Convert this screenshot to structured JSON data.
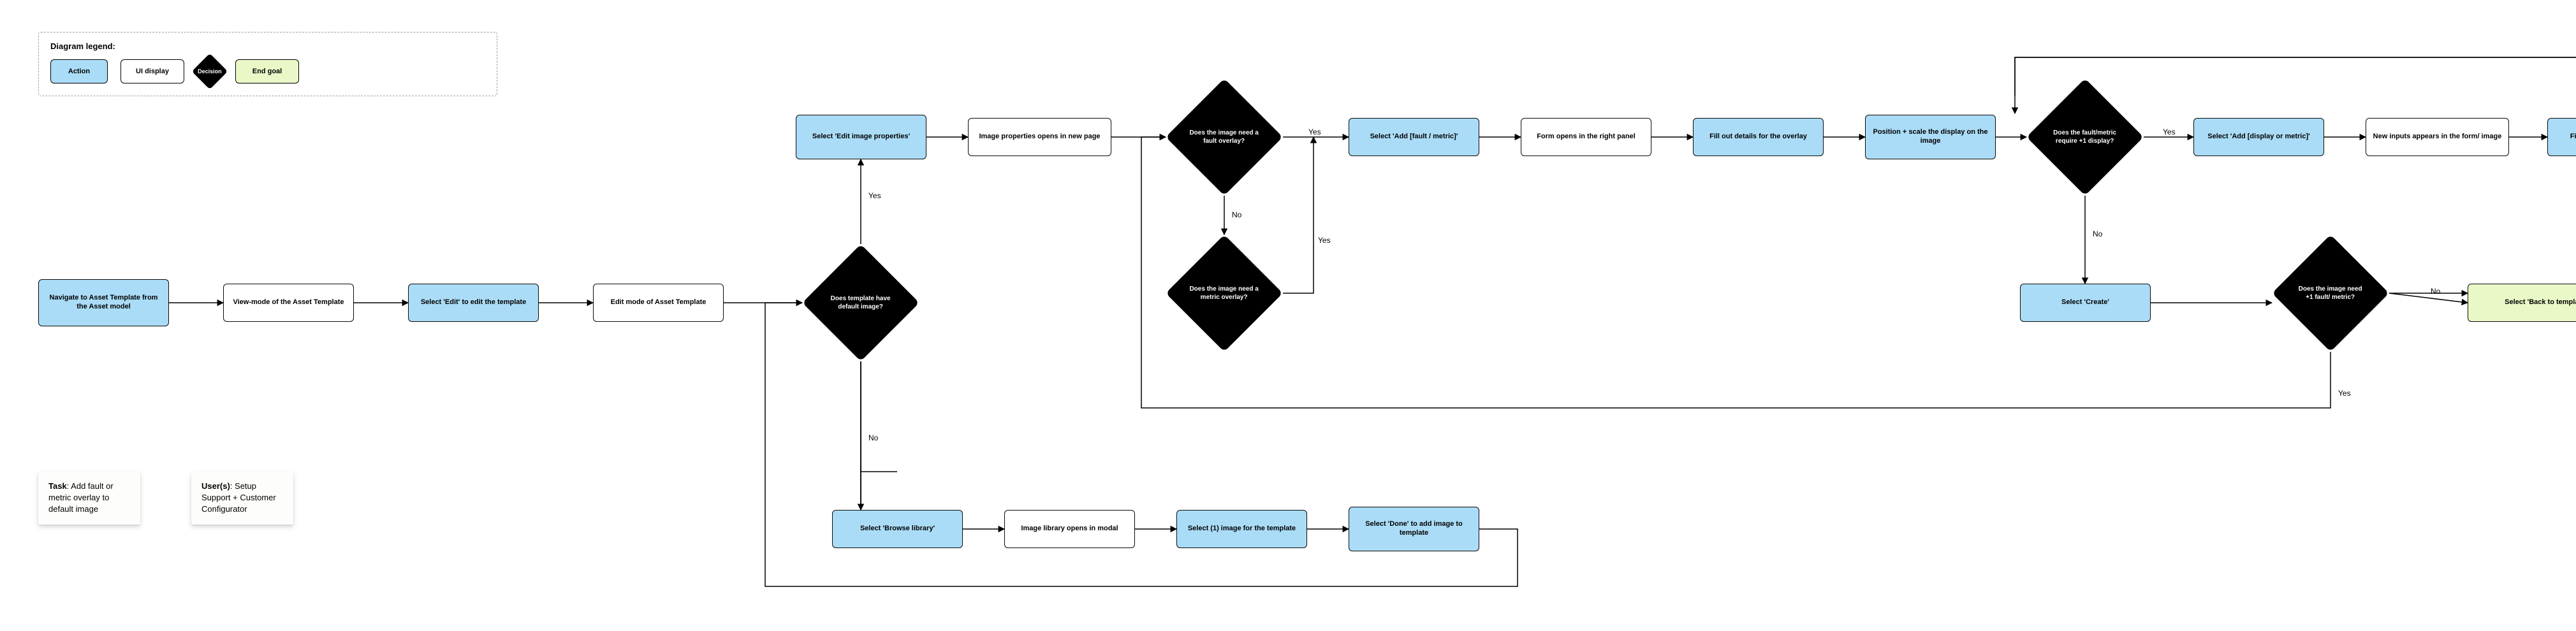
{
  "legend": {
    "title": "Diagram legend:",
    "action": "Action",
    "ui_display": "UI display",
    "decision": "Decision",
    "end_goal": "End goal"
  },
  "stickies": {
    "task": {
      "label": "Task",
      "text": ": Add fault or metric overlay to default image"
    },
    "users": {
      "label": "User(s)",
      "text": ": Setup Support + Customer Configurator"
    }
  },
  "nodes": {
    "nav": "Navigate to Asset Template from the Asset model",
    "view_mode": "View-mode of the Asset Template",
    "select_edit": "Select 'Edit' to edit the template",
    "edit_mode": "Edit mode of Asset Template",
    "d_has_default": "Does template have default image?",
    "edit_img_props": "Select 'Edit image properties'",
    "img_props_page": "Image properties opens in new page",
    "d_need_fault": "Does the image need a fault overlay?",
    "d_need_metric": "Does the image need a metric overlay?",
    "add_fault_metric": "Select 'Add [fault / metric]'",
    "form_opens": "Form opens in the right panel",
    "fill_details": "Fill out details for the overlay",
    "position_scale": "Position + scale the display on the image",
    "d_plus1_display": "Does the fault/metric require +1 display?",
    "add_display_metric": "Select 'Add [display or metric]'",
    "new_inputs": "New inputs appears in the form/ image",
    "fill_new": "Fill out new inputs",
    "select_create": "Select 'Create'",
    "d_plus1_fm": "Does the image need +1 fault/ metric?",
    "back_template": "Select 'Back to template'",
    "browse_library": "Select 'Browse library'",
    "library_modal": "Image library opens in modal",
    "select_one_img": "Select (1) image for the template",
    "select_done": "Select 'Done' to add image to template"
  },
  "edges": {
    "yes": "Yes",
    "no": "No"
  }
}
